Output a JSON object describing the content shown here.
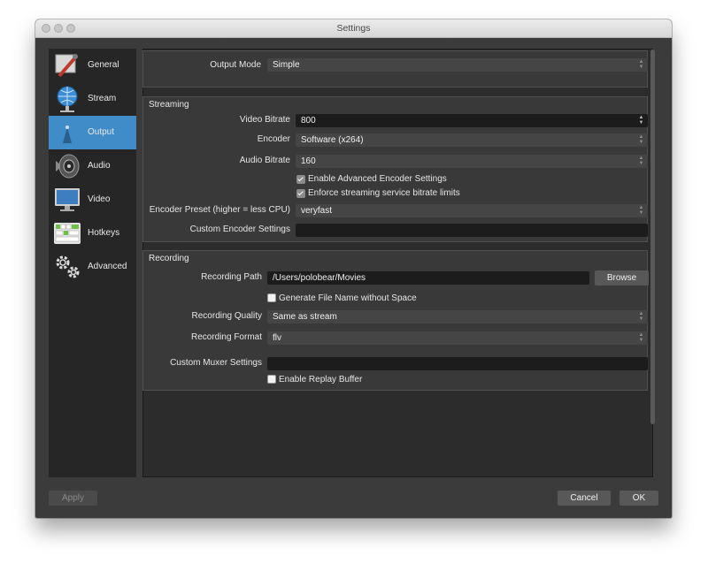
{
  "window": {
    "title": "Settings"
  },
  "sidebar": {
    "items": [
      {
        "label": "General",
        "icon": "general-icon",
        "selected": false
      },
      {
        "label": "Stream",
        "icon": "stream-icon",
        "selected": false
      },
      {
        "label": "Output",
        "icon": "output-icon",
        "selected": true
      },
      {
        "label": "Audio",
        "icon": "audio-icon",
        "selected": false
      },
      {
        "label": "Video",
        "icon": "video-icon",
        "selected": false
      },
      {
        "label": "Hotkeys",
        "icon": "hotkeys-icon",
        "selected": false
      },
      {
        "label": "Advanced",
        "icon": "advanced-icon",
        "selected": false
      }
    ]
  },
  "output_mode": {
    "label": "Output Mode",
    "value": "Simple"
  },
  "streaming": {
    "title": "Streaming",
    "video_bitrate": {
      "label": "Video Bitrate",
      "value": "800"
    },
    "encoder": {
      "label": "Encoder",
      "value": "Software (x264)"
    },
    "audio_bitrate": {
      "label": "Audio Bitrate",
      "value": "160"
    },
    "advanced_encoder": {
      "label": "Enable Advanced Encoder Settings",
      "checked": true
    },
    "enforce_limits": {
      "label": "Enforce streaming service bitrate limits",
      "checked": true
    },
    "encoder_preset": {
      "label": "Encoder Preset (higher = less CPU)",
      "value": "veryfast"
    },
    "custom_encoder": {
      "label": "Custom Encoder Settings",
      "value": ""
    }
  },
  "recording": {
    "title": "Recording",
    "path": {
      "label": "Recording Path",
      "value": "/Users/polobear/Movies"
    },
    "browse_label": "Browse",
    "no_space": {
      "label": "Generate File Name without Space",
      "checked": false
    },
    "quality": {
      "label": "Recording Quality",
      "value": "Same as stream"
    },
    "format": {
      "label": "Recording Format",
      "value": "flv"
    },
    "muxer": {
      "label": "Custom Muxer Settings",
      "value": ""
    },
    "replay_buffer": {
      "label": "Enable Replay Buffer",
      "checked": false
    }
  },
  "footer": {
    "apply_label": "Apply",
    "cancel_label": "Cancel",
    "ok_label": "OK"
  },
  "colors": {
    "accent": "#3f8cc9",
    "window_bg": "#3b3b3b",
    "sidebar_bg": "#262626"
  }
}
